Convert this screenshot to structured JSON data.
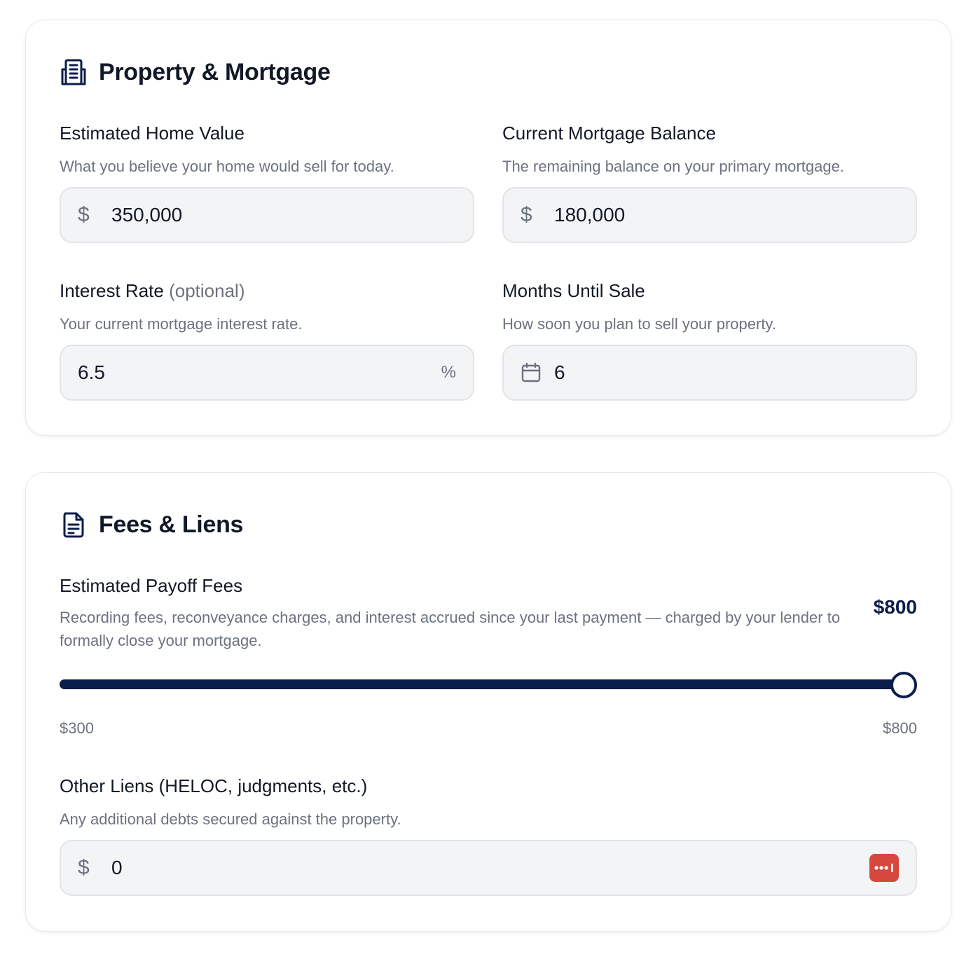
{
  "property": {
    "title": "Property & Mortgage",
    "icon": "building-icon",
    "home_value": {
      "label": "Estimated Home Value",
      "help": "What you believe your home would sell for today.",
      "prefix": "$",
      "value": "350,000"
    },
    "mortgage_balance": {
      "label": "Current Mortgage Balance",
      "help": "The remaining balance on your primary mortgage.",
      "prefix": "$",
      "value": "180,000"
    },
    "interest_rate": {
      "label": "Interest Rate",
      "optional": "(optional)",
      "help": "Your current mortgage interest rate.",
      "value": "6.5",
      "suffix": "%"
    },
    "months_until_sale": {
      "label": "Months Until Sale",
      "help": "How soon you plan to sell your property.",
      "icon": "calendar-icon",
      "value": "6"
    }
  },
  "fees": {
    "title": "Fees & Liens",
    "icon": "document-icon",
    "payoff": {
      "label": "Estimated Payoff Fees",
      "help": "Recording fees, reconveyance charges, and interest accrued since your last payment — charged by your lender to formally close your mortgage.",
      "value_display": "$800",
      "min_label": "$300",
      "max_label": "$800",
      "min": 300,
      "max": 800,
      "value": 800
    },
    "other_liens": {
      "label": "Other Liens (HELOC, judgments, etc.)",
      "help": "Any additional debts secured against the property.",
      "prefix": "$",
      "value": "0",
      "badge_icon": "password-manager-icon"
    }
  },
  "colors": {
    "accent": "#0b1d4a",
    "muted": "#6b7280",
    "input_bg": "#f3f4f6",
    "badge": "#d6483e"
  }
}
